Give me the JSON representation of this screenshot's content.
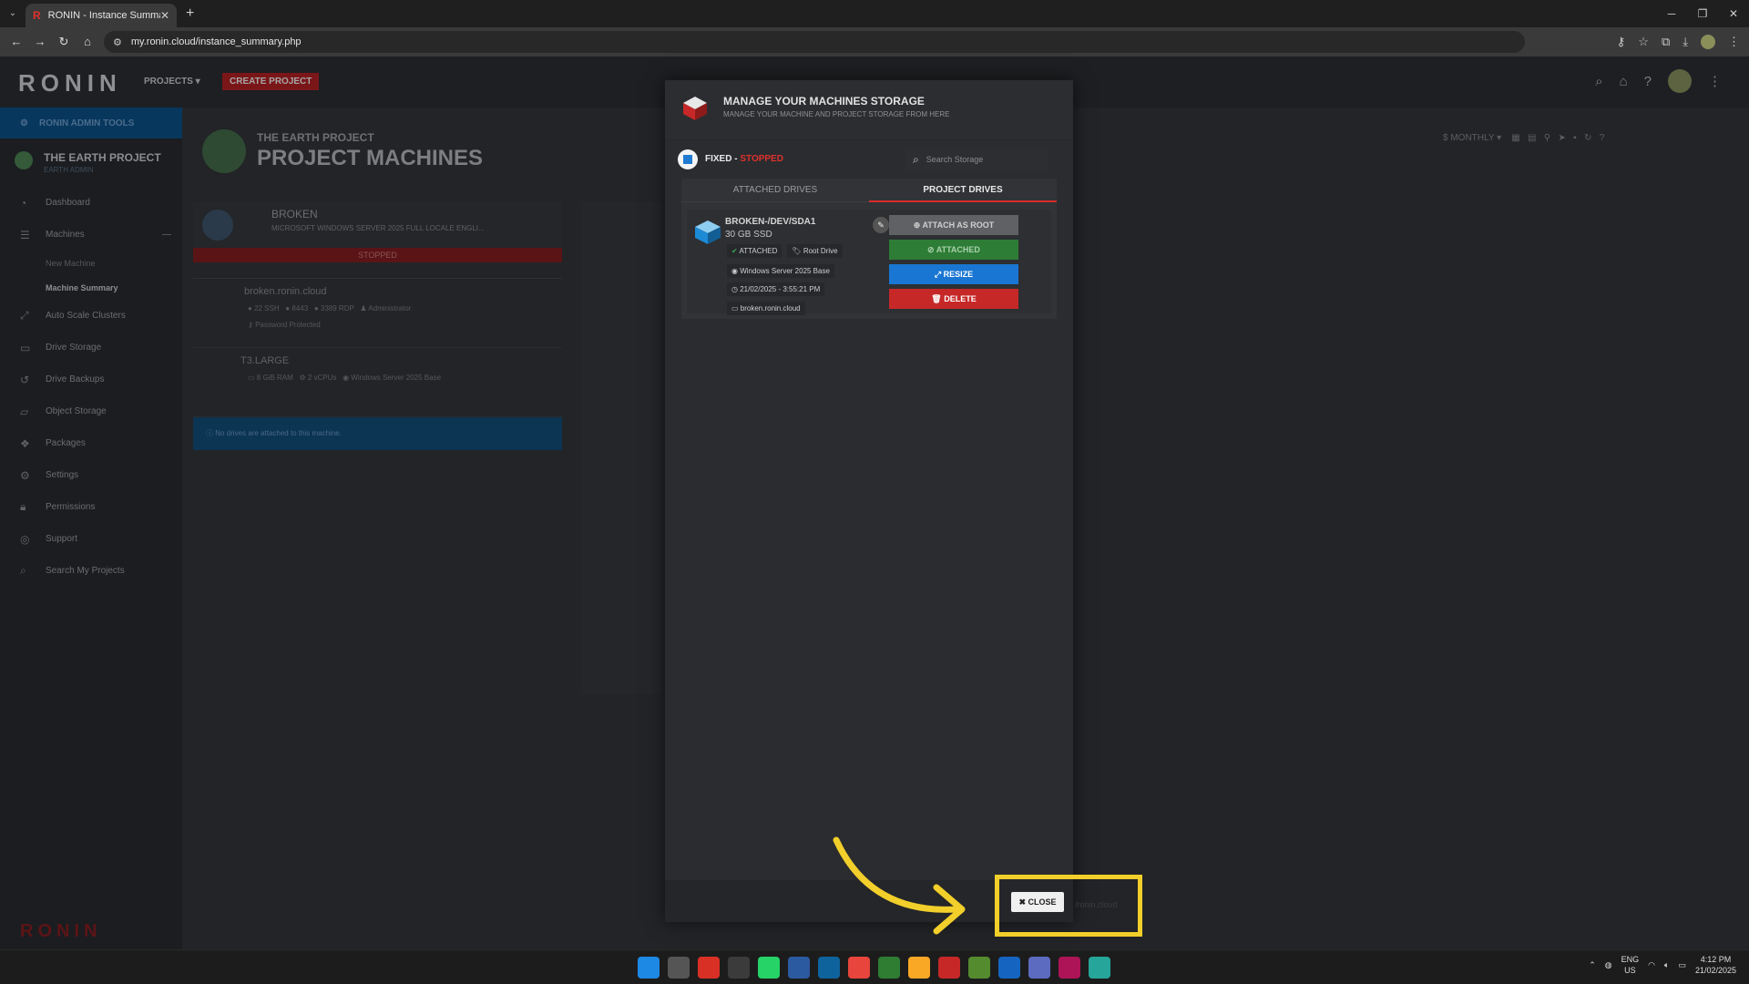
{
  "browser": {
    "tab_title": "RONIN - Instance Summary",
    "tab_favicon": "R",
    "url": "my.ronin.cloud/instance_summary.php"
  },
  "app": {
    "logo": "RONIN",
    "nav_projects": "PROJECTS",
    "nav_create": "CREATE PROJECT",
    "admin_tools": "RONIN ADMIN TOOLS",
    "project_name": "THE EARTH PROJECT",
    "project_crumbs": "EARTH ADMIN",
    "sidebar": {
      "items": [
        {
          "label": "Dashboard",
          "icon": "dashboard-icon"
        },
        {
          "label": "Machines",
          "icon": "server-icon"
        },
        {
          "label": "Auto Scale Clusters",
          "icon": "expand-icon"
        },
        {
          "label": "Drive Storage",
          "icon": "drive-icon"
        },
        {
          "label": "Drive Backups",
          "icon": "history-icon"
        },
        {
          "label": "Object Storage",
          "icon": "folder-icon"
        },
        {
          "label": "Packages",
          "icon": "packages-icon"
        },
        {
          "label": "Settings",
          "icon": "gear-icon"
        },
        {
          "label": "Permissions",
          "icon": "lock-icon"
        },
        {
          "label": "Support",
          "icon": "support-icon"
        },
        {
          "label": "Search My Projects",
          "icon": "search-icon"
        }
      ],
      "machine_sub": [
        "New Machine",
        "Machine Summary"
      ]
    },
    "page_subtitle": "THE EARTH PROJECT",
    "page_title": "PROJECT MACHINES",
    "toolbar_period": "MONTHLY",
    "machine_card": {
      "name": "BROKEN",
      "os": "MICROSOFT WINDOWS SERVER 2025 FULL LOCALE ENGLI...",
      "status": "STOPPED",
      "host": "broken.ronin.cloud",
      "ports": [
        "22 SSH",
        "8443",
        "3389 RDP",
        "Administrator"
      ],
      "password": "Password Protected",
      "instance_type": "T3.LARGE",
      "specs": [
        "8 GiB RAM",
        "2 vCPUs",
        "Windows Server 2025 Base"
      ],
      "no_drives": "No drives are attached to this machine."
    },
    "footer_logo": "RONIN"
  },
  "modal": {
    "title": "MANAGE YOUR MACHINES STORAGE",
    "subtitle": "MANAGE YOUR MACHINE AND PROJECT STORAGE FROM HERE",
    "fixed_label": "FIXED - ",
    "fixed_status": "STOPPED",
    "search_placeholder": "Search Storage",
    "tabs": [
      "ATTACHED DRIVES",
      "PROJECT DRIVES"
    ],
    "drive": {
      "name": "BROKEN-/DEV/SDA1",
      "size": "30 GB SSD",
      "tag_attached": "ATTACHED",
      "tag_root": "Root Drive",
      "os": "Windows Server 2025 Base",
      "date": "21/02/2025 - 3:55:21 PM",
      "host": "broken.ronin.cloud"
    },
    "buttons": {
      "attach_root": "ATTACH AS ROOT",
      "attached": "ATTACHED",
      "resize": "RESIZE",
      "delete": "DELETE"
    },
    "close": "CLOSE",
    "footer_url": "/ronin.cloud"
  },
  "taskbar": {
    "lang1": "ENG",
    "lang2": "US",
    "time": "4:12 PM",
    "date": "21/02/2025"
  },
  "colors": {
    "accent_red": "#c62828",
    "accent_blue": "#1976d2",
    "accent_green": "#2e7d36",
    "highlight_yellow": "#f2cf2a"
  }
}
